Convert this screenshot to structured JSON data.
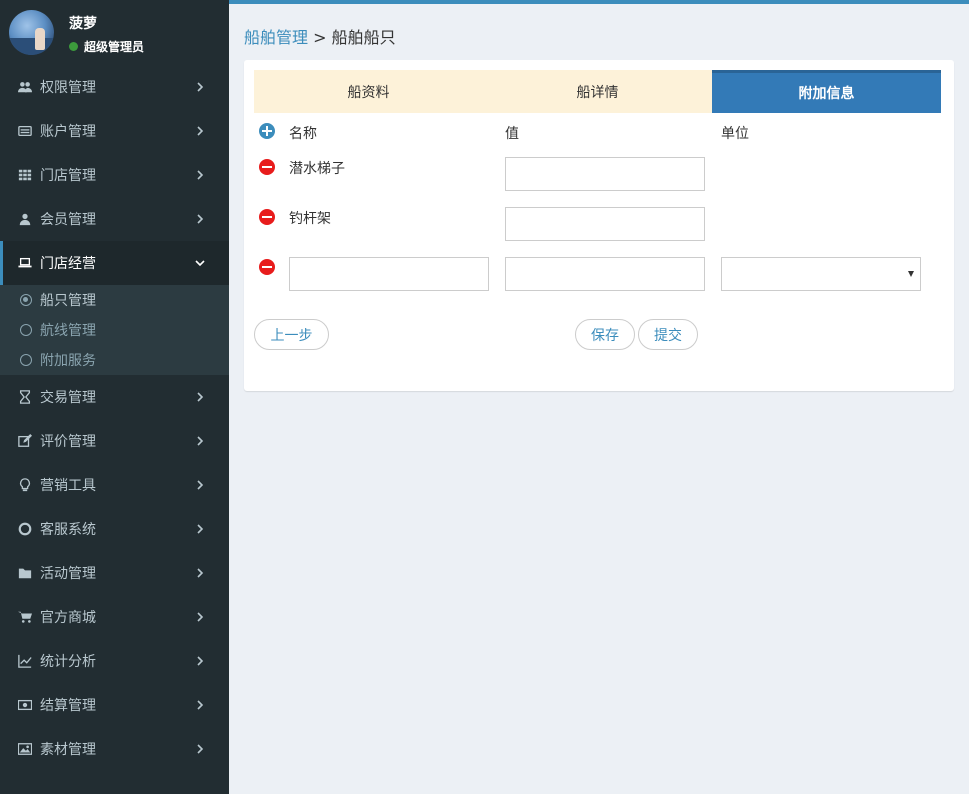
{
  "user": {
    "name": "菠萝",
    "role": "超级管理员"
  },
  "menu": [
    {
      "label": "权限管理",
      "icon": "users-icon"
    },
    {
      "label": "账户管理",
      "icon": "list-icon"
    },
    {
      "label": "门店管理",
      "icon": "grid-icon"
    },
    {
      "label": "会员管理",
      "icon": "user-icon"
    },
    {
      "label": "门店经营",
      "icon": "laptop-icon",
      "active": true
    },
    {
      "label": "交易管理",
      "icon": "hourglass-icon"
    },
    {
      "label": "评价管理",
      "icon": "edit-icon"
    },
    {
      "label": "营销工具",
      "icon": "lightbulb-icon"
    },
    {
      "label": "客服系统",
      "icon": "lifebuoy-icon"
    },
    {
      "label": "活动管理",
      "icon": "folder-icon"
    },
    {
      "label": "官方商城",
      "icon": "cart-icon"
    },
    {
      "label": "统计分析",
      "icon": "line-chart-icon"
    },
    {
      "label": "结算管理",
      "icon": "money-icon"
    },
    {
      "label": "素材管理",
      "icon": "image-icon"
    }
  ],
  "submenu": [
    {
      "label": "船只管理",
      "current": true
    },
    {
      "label": "航线管理"
    },
    {
      "label": "附加服务"
    }
  ],
  "breadcrumb": {
    "parent": "船舶管理",
    "separator": ">",
    "current": "船舶船只"
  },
  "tabs": [
    {
      "label": "船资料"
    },
    {
      "label": "船详情"
    },
    {
      "label": "附加信息",
      "active": true
    }
  ],
  "columns": {
    "name": "名称",
    "value": "值",
    "unit": "单位"
  },
  "rows": [
    {
      "name": "潜水梯子",
      "value": ""
    },
    {
      "name": "钓杆架",
      "value": ""
    }
  ],
  "new_row": {
    "name": "",
    "value": "",
    "unit": ""
  },
  "buttons": {
    "prev": "上一步",
    "save": "保存",
    "submit": "提交"
  }
}
